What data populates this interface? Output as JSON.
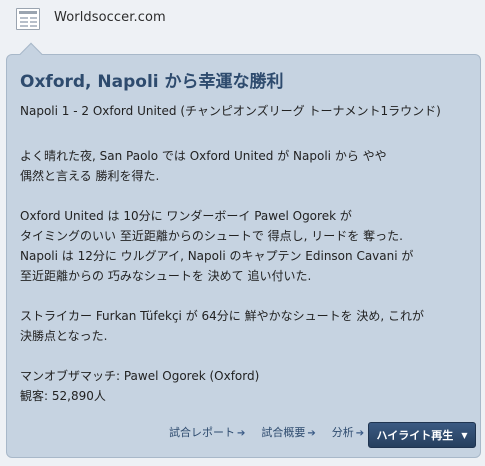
{
  "header": {
    "source": "Worldsoccer.com",
    "icon": "newspaper-icon"
  },
  "article": {
    "title": "Oxford, Napoli から幸運な勝利",
    "match_line": "Napoli 1 - 2 Oxford United (チャンピオンズリーグ トーナメント1ラウンド)",
    "paragraphs": [
      [
        "よく晴れた夜, San Paolo では Oxford United が Napoli から やや",
        "偶然と言える 勝利を得た."
      ],
      [
        "Oxford United は 10分に ワンダーボーイ Pawel Ogorek が",
        "タイミングのいい 至近距離からのシュートで 得点し, リードを 奪った.",
        "Napoli は 12分に ウルグアイ, Napoli のキャプテン Edinson Cavani が",
        "至近距離からの 巧みなシュートを 決めて 追い付いた."
      ],
      [
        "ストライカー Furkan Tüfekçi が 64分に 鮮やかなシュートを 決め, これが",
        "決勝点となった."
      ]
    ],
    "man_of_match": "マンオブザマッチ: Pawel Ogorek (Oxford)",
    "attendance": "観客: 52,890人"
  },
  "footer": {
    "links": [
      "試合レポート",
      "試合概要",
      "分析"
    ],
    "highlight_button": "ハイライト再生"
  },
  "colors": {
    "card_bg": "#c6d3e1",
    "title": "#2e4b6e",
    "button_bg": "#2f4a6d"
  }
}
